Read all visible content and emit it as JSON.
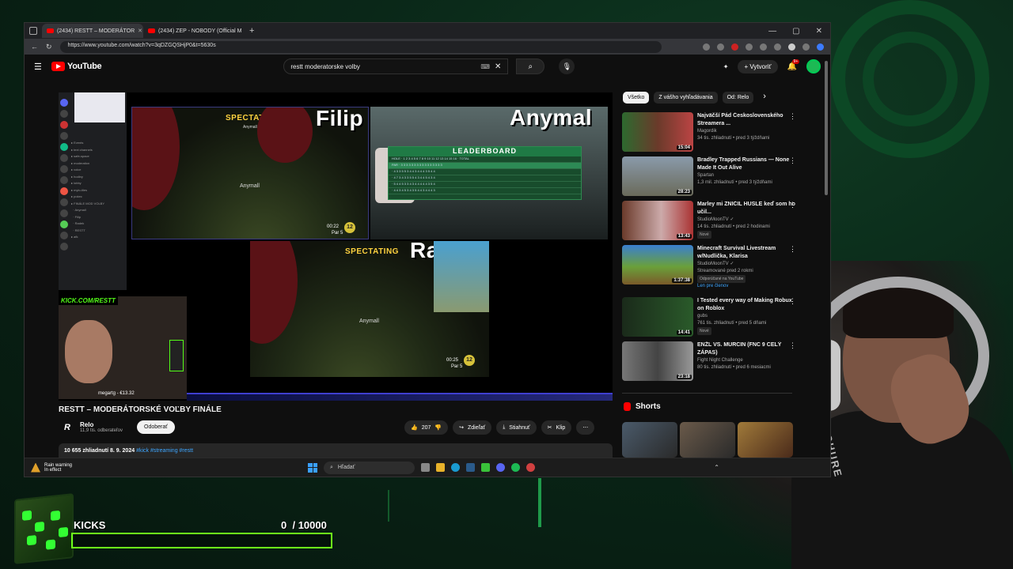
{
  "browser": {
    "tabs": [
      {
        "title": "(2434) RESTT – MODERÁTOR",
        "active": true
      },
      {
        "title": "(2434) ZEP - NOBODY (Official M",
        "active": false
      }
    ],
    "url": "https://www.youtube.com/watch?v=3qDZGQSHjP0&t=5630s"
  },
  "youtube": {
    "logo": "YouTube",
    "search_value": "restt moderatorske volby",
    "create_label": "Vytvoriť",
    "notif_count": "9+"
  },
  "video": {
    "players": {
      "p1": {
        "name": "Filip",
        "spectating": "SPECTATING",
        "sub": "Anymall",
        "inlabel": "Anymall",
        "timer": "00:22",
        "par": "Par 5"
      },
      "p2": {
        "name": "Anymal",
        "leaderboard": "LEADERBOARD"
      },
      "p3": {
        "name": "Radek",
        "spectating": "SPECTATING",
        "inlabel": "Anymall",
        "timer": "00:25",
        "par": "Par 5"
      }
    },
    "kick_label": "KICK.COM/RESTT",
    "donation": "megartg - €13.32",
    "title": "RESTT – MODERÁTORSKÉ VOĽBY FINÁLE"
  },
  "channel": {
    "name": "Relo",
    "subs": "11,9 tis. odberateľov",
    "subscribe_label": "Odoberať"
  },
  "actions": {
    "likes": "207",
    "share": "Zdieľať",
    "download": "Stiahnuť",
    "clip": "Klip"
  },
  "description": {
    "views_date": "10 655 zhliadnutí  8. 9. 2024",
    "tags": "#kick #streaming #restt"
  },
  "chips": [
    "Všetko",
    "Z vášho vyhľadávania",
    "Od: Relo"
  ],
  "recs": [
    {
      "title": "Najväčší Pád Československého Streamera ...",
      "channel": "Magordik",
      "stats": "34 tis. zhliadnutí • pred 3 týždňami",
      "duration": "15:04",
      "badge": "",
      "color": "#3a2a20"
    },
    {
      "title": "Bradley Trapped Russians — None Made It Out Alive",
      "channel": "Spartan",
      "stats": "1,3 mil. zhliadnutí • pred 3 týždňami",
      "duration": "28:23",
      "badge": "",
      "color": "#8a8f7a"
    },
    {
      "title": "Marley mi ZNIČIL HUSLE keď som ho učil...",
      "channel": "StudioMoonTV ✓",
      "stats": "14 tis. zhliadnutí • pred 2 hodinami",
      "duration": "13:43",
      "badge": "Nové",
      "color": "#6a3a30"
    },
    {
      "title": "Minecraft Survival Livestream w/Nudlička, Klarisa",
      "channel": "StudioMoonTV ✓",
      "stats": "Streamované pred 2 rokmi",
      "duration": "1:37:38",
      "badge": "Odporúčané na YouTube",
      "extra": "Len pre členov",
      "color": "#5a8a3a"
    },
    {
      "title": "I Tested every way of Making Robux on Roblox",
      "channel": "gubs",
      "stats": "761 tis. zhliadnutí • pred 5 dňami",
      "duration": "14:41",
      "badge": "Nové",
      "color": "#1f3a1f"
    },
    {
      "title": "ENŽL VS. MURCIN (FNC 9 CELÝ ZÁPAS)",
      "channel": "Fight Night Challenge",
      "stats": "80 tis. zhliadnutí • pred 6 mesiacmi",
      "duration": "23:18",
      "badge": "",
      "color": "#555"
    }
  ],
  "shorts_title": "Shorts",
  "taskbar": {
    "weather_line1": "Rain warning",
    "weather_line2": "In effect",
    "search_placeholder": "Hľadať"
  },
  "overlay": {
    "kicks_label": "KICKS",
    "kicks_progress": "0",
    "kicks_goal": "/ 10000",
    "accent": "#6dff1a"
  }
}
